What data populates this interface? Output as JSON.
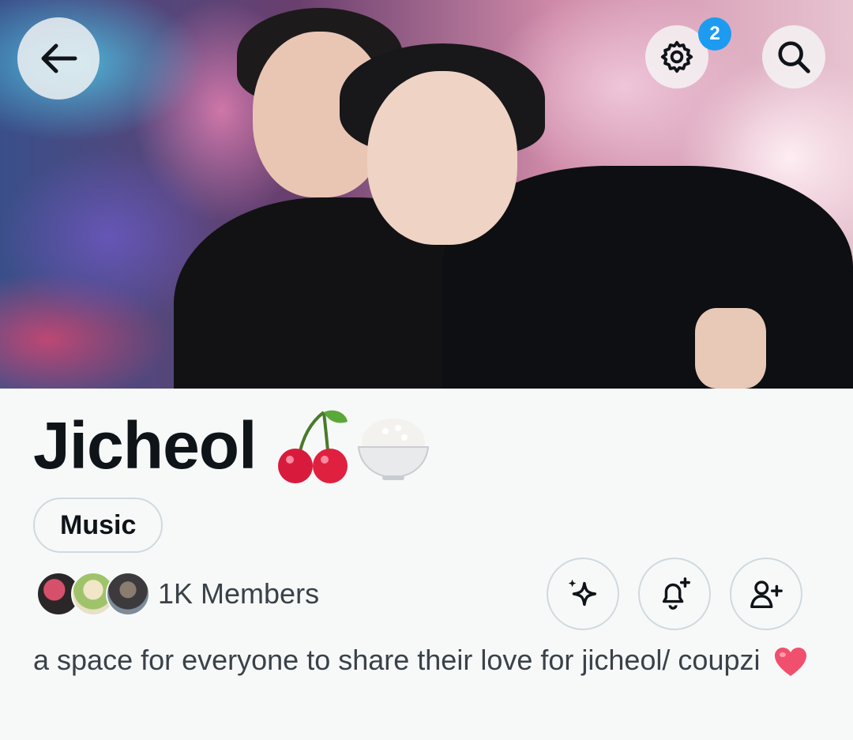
{
  "header": {
    "notification_count": "2",
    "icons": [
      "back-arrow-icon",
      "gear-icon",
      "search-icon"
    ],
    "accent": "#1d9bf0"
  },
  "community": {
    "name": "Jicheol",
    "name_emojis": [
      "cherries",
      "rice-bowl"
    ],
    "category": "Music",
    "members_label": "1K Members",
    "description": "a space for everyone to share their love for jicheol/ coupzi",
    "description_emoji": "heart"
  },
  "actions": {
    "icons": [
      "sparkle-icon",
      "bell-plus-icon",
      "person-plus-icon"
    ]
  }
}
